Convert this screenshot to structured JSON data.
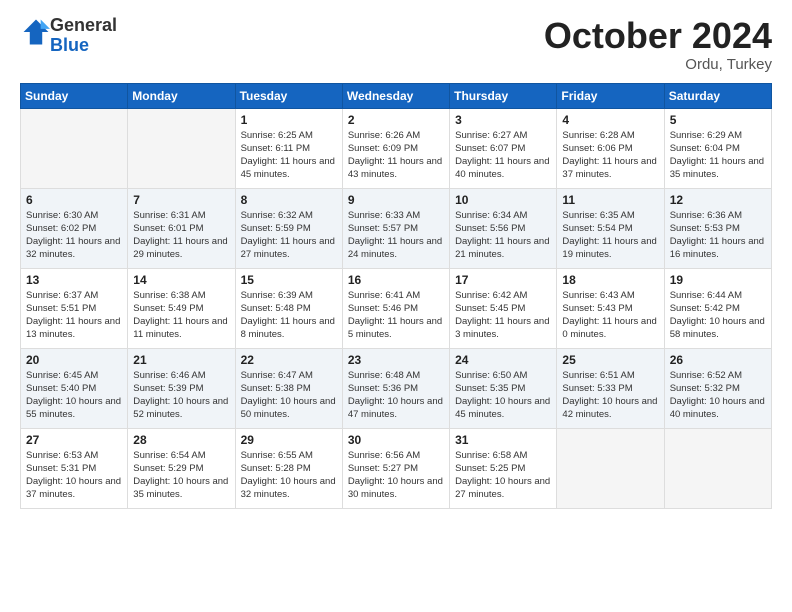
{
  "logo": {
    "general": "General",
    "blue": "Blue"
  },
  "title": "October 2024",
  "subtitle": "Ordu, Turkey",
  "days_of_week": [
    "Sunday",
    "Monday",
    "Tuesday",
    "Wednesday",
    "Thursday",
    "Friday",
    "Saturday"
  ],
  "weeks": [
    [
      {
        "day": "",
        "sunrise": "",
        "sunset": "",
        "daylight": "",
        "empty": true
      },
      {
        "day": "",
        "sunrise": "",
        "sunset": "",
        "daylight": "",
        "empty": true
      },
      {
        "day": "1",
        "sunrise": "Sunrise: 6:25 AM",
        "sunset": "Sunset: 6:11 PM",
        "daylight": "Daylight: 11 hours and 45 minutes."
      },
      {
        "day": "2",
        "sunrise": "Sunrise: 6:26 AM",
        "sunset": "Sunset: 6:09 PM",
        "daylight": "Daylight: 11 hours and 43 minutes."
      },
      {
        "day": "3",
        "sunrise": "Sunrise: 6:27 AM",
        "sunset": "Sunset: 6:07 PM",
        "daylight": "Daylight: 11 hours and 40 minutes."
      },
      {
        "day": "4",
        "sunrise": "Sunrise: 6:28 AM",
        "sunset": "Sunset: 6:06 PM",
        "daylight": "Daylight: 11 hours and 37 minutes."
      },
      {
        "day": "5",
        "sunrise": "Sunrise: 6:29 AM",
        "sunset": "Sunset: 6:04 PM",
        "daylight": "Daylight: 11 hours and 35 minutes."
      }
    ],
    [
      {
        "day": "6",
        "sunrise": "Sunrise: 6:30 AM",
        "sunset": "Sunset: 6:02 PM",
        "daylight": "Daylight: 11 hours and 32 minutes."
      },
      {
        "day": "7",
        "sunrise": "Sunrise: 6:31 AM",
        "sunset": "Sunset: 6:01 PM",
        "daylight": "Daylight: 11 hours and 29 minutes."
      },
      {
        "day": "8",
        "sunrise": "Sunrise: 6:32 AM",
        "sunset": "Sunset: 5:59 PM",
        "daylight": "Daylight: 11 hours and 27 minutes."
      },
      {
        "day": "9",
        "sunrise": "Sunrise: 6:33 AM",
        "sunset": "Sunset: 5:57 PM",
        "daylight": "Daylight: 11 hours and 24 minutes."
      },
      {
        "day": "10",
        "sunrise": "Sunrise: 6:34 AM",
        "sunset": "Sunset: 5:56 PM",
        "daylight": "Daylight: 11 hours and 21 minutes."
      },
      {
        "day": "11",
        "sunrise": "Sunrise: 6:35 AM",
        "sunset": "Sunset: 5:54 PM",
        "daylight": "Daylight: 11 hours and 19 minutes."
      },
      {
        "day": "12",
        "sunrise": "Sunrise: 6:36 AM",
        "sunset": "Sunset: 5:53 PM",
        "daylight": "Daylight: 11 hours and 16 minutes."
      }
    ],
    [
      {
        "day": "13",
        "sunrise": "Sunrise: 6:37 AM",
        "sunset": "Sunset: 5:51 PM",
        "daylight": "Daylight: 11 hours and 13 minutes."
      },
      {
        "day": "14",
        "sunrise": "Sunrise: 6:38 AM",
        "sunset": "Sunset: 5:49 PM",
        "daylight": "Daylight: 11 hours and 11 minutes."
      },
      {
        "day": "15",
        "sunrise": "Sunrise: 6:39 AM",
        "sunset": "Sunset: 5:48 PM",
        "daylight": "Daylight: 11 hours and 8 minutes."
      },
      {
        "day": "16",
        "sunrise": "Sunrise: 6:41 AM",
        "sunset": "Sunset: 5:46 PM",
        "daylight": "Daylight: 11 hours and 5 minutes."
      },
      {
        "day": "17",
        "sunrise": "Sunrise: 6:42 AM",
        "sunset": "Sunset: 5:45 PM",
        "daylight": "Daylight: 11 hours and 3 minutes."
      },
      {
        "day": "18",
        "sunrise": "Sunrise: 6:43 AM",
        "sunset": "Sunset: 5:43 PM",
        "daylight": "Daylight: 11 hours and 0 minutes."
      },
      {
        "day": "19",
        "sunrise": "Sunrise: 6:44 AM",
        "sunset": "Sunset: 5:42 PM",
        "daylight": "Daylight: 10 hours and 58 minutes."
      }
    ],
    [
      {
        "day": "20",
        "sunrise": "Sunrise: 6:45 AM",
        "sunset": "Sunset: 5:40 PM",
        "daylight": "Daylight: 10 hours and 55 minutes."
      },
      {
        "day": "21",
        "sunrise": "Sunrise: 6:46 AM",
        "sunset": "Sunset: 5:39 PM",
        "daylight": "Daylight: 10 hours and 52 minutes."
      },
      {
        "day": "22",
        "sunrise": "Sunrise: 6:47 AM",
        "sunset": "Sunset: 5:38 PM",
        "daylight": "Daylight: 10 hours and 50 minutes."
      },
      {
        "day": "23",
        "sunrise": "Sunrise: 6:48 AM",
        "sunset": "Sunset: 5:36 PM",
        "daylight": "Daylight: 10 hours and 47 minutes."
      },
      {
        "day": "24",
        "sunrise": "Sunrise: 6:50 AM",
        "sunset": "Sunset: 5:35 PM",
        "daylight": "Daylight: 10 hours and 45 minutes."
      },
      {
        "day": "25",
        "sunrise": "Sunrise: 6:51 AM",
        "sunset": "Sunset: 5:33 PM",
        "daylight": "Daylight: 10 hours and 42 minutes."
      },
      {
        "day": "26",
        "sunrise": "Sunrise: 6:52 AM",
        "sunset": "Sunset: 5:32 PM",
        "daylight": "Daylight: 10 hours and 40 minutes."
      }
    ],
    [
      {
        "day": "27",
        "sunrise": "Sunrise: 6:53 AM",
        "sunset": "Sunset: 5:31 PM",
        "daylight": "Daylight: 10 hours and 37 minutes."
      },
      {
        "day": "28",
        "sunrise": "Sunrise: 6:54 AM",
        "sunset": "Sunset: 5:29 PM",
        "daylight": "Daylight: 10 hours and 35 minutes."
      },
      {
        "day": "29",
        "sunrise": "Sunrise: 6:55 AM",
        "sunset": "Sunset: 5:28 PM",
        "daylight": "Daylight: 10 hours and 32 minutes."
      },
      {
        "day": "30",
        "sunrise": "Sunrise: 6:56 AM",
        "sunset": "Sunset: 5:27 PM",
        "daylight": "Daylight: 10 hours and 30 minutes."
      },
      {
        "day": "31",
        "sunrise": "Sunrise: 6:58 AM",
        "sunset": "Sunset: 5:25 PM",
        "daylight": "Daylight: 10 hours and 27 minutes."
      },
      {
        "day": "",
        "sunrise": "",
        "sunset": "",
        "daylight": "",
        "empty": true
      },
      {
        "day": "",
        "sunrise": "",
        "sunset": "",
        "daylight": "",
        "empty": true
      }
    ]
  ]
}
